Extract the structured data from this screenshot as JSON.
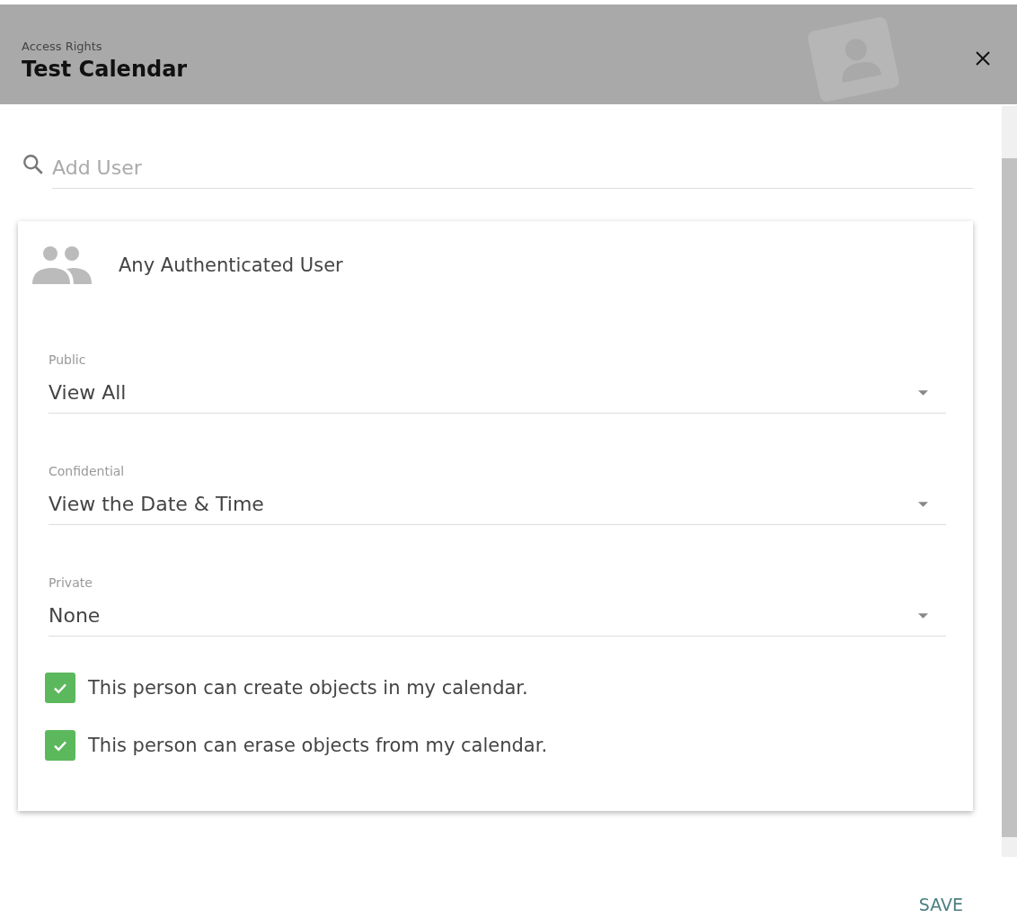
{
  "header": {
    "subtitle": "Access Rights",
    "title": "Test Calendar"
  },
  "search": {
    "placeholder": "Add User"
  },
  "entry": {
    "name": "Any Authenticated User",
    "selects": [
      {
        "label": "Public",
        "value": "View All"
      },
      {
        "label": "Confidential",
        "value": "View the Date & Time"
      },
      {
        "label": "Private",
        "value": "None"
      }
    ],
    "permissions": [
      {
        "label": "This person can create objects in my calendar.",
        "checked": true
      },
      {
        "label": "This person can erase objects from my calendar.",
        "checked": true
      }
    ]
  },
  "actions": {
    "save": "SAVE"
  }
}
